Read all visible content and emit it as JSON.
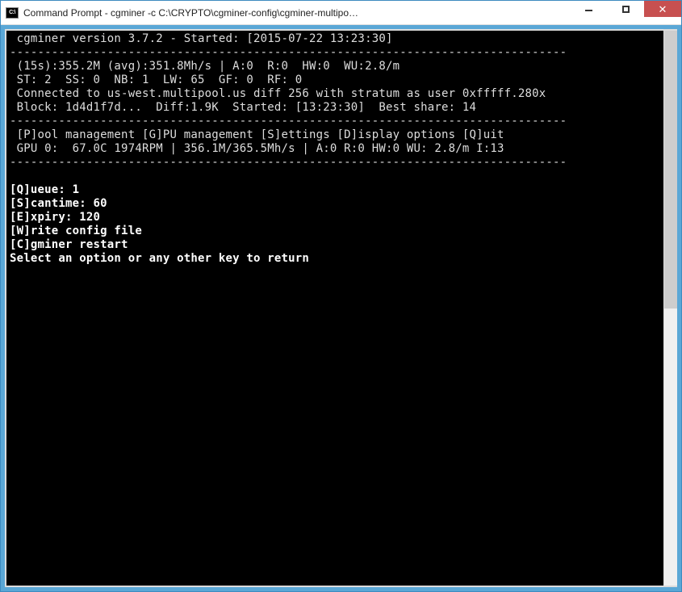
{
  "window": {
    "title": "Command Prompt - cgminer  -c C:\\CRYPTO\\cgminer-config\\cgminer-multipo…",
    "icon_label": "C:\\"
  },
  "term": {
    "line_version": " cgminer version 3.7.2 - Started: [2015-07-22 13:23:30]",
    "sep": "--------------------------------------------------------------------------------",
    "line_stats1": " (15s):355.2M (avg):351.8Mh/s | A:0  R:0  HW:0  WU:2.8/m",
    "line_stats2": " ST: 2  SS: 0  NB: 1  LW: 65  GF: 0  RF: 0",
    "line_conn": " Connected to us-west.multipool.us diff 256 with stratum as user 0xfffff.280x",
    "line_block": " Block: 1d4d1f7d...  Diff:1.9K  Started: [13:23:30]  Best share: 14",
    "line_menu": " [P]ool management [G]PU management [S]ettings [D]isplay options [Q]uit",
    "line_gpu": " GPU 0:  67.0C 1974RPM | 356.1M/365.5Mh/s | A:0 R:0 HW:0 WU: 2.8/m I:13",
    "blank": "",
    "opt_queue": "[Q]ueue: 1",
    "opt_scan": "[S]cantime: 60",
    "opt_expiry": "[E]xpiry: 120",
    "opt_write": "[W]rite config file",
    "opt_restart": "[C]gminer restart",
    "prompt": "Select an option or any other key to return"
  }
}
